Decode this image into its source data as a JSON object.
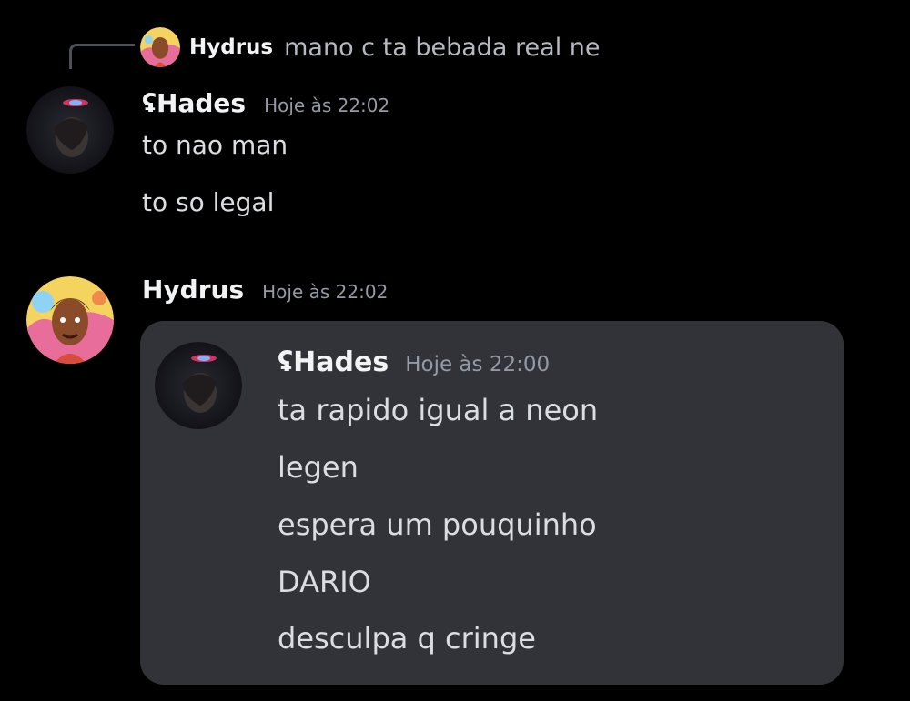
{
  "reply": {
    "author": "Hydrus",
    "text": "mano c ta bebada real ne"
  },
  "messages": [
    {
      "author": "ʢHades",
      "timestamp": "Hoje às 22:02",
      "lines": [
        "to nao man",
        "to so legal"
      ]
    },
    {
      "author": "Hydrus",
      "timestamp": "Hoje às 22:02",
      "attachment": {
        "author": "ʢHades",
        "timestamp": "Hoje às 22:00",
        "lines": [
          "ta rapido igual a neon",
          "legen",
          "espera um pouquinho",
          "DARIO",
          "desculpa q cringe"
        ]
      }
    }
  ],
  "colors": {
    "background": "#000000",
    "card": "#313338",
    "username": "#f2f3f5",
    "message_text": "#dbdee1",
    "timestamp": "#949ba4",
    "reply_spine": "#4e5058"
  },
  "icons": {
    "hades_avatar": "dark-portrait-avatar",
    "hydrus_avatar": "cartoon-portrait-avatar"
  }
}
